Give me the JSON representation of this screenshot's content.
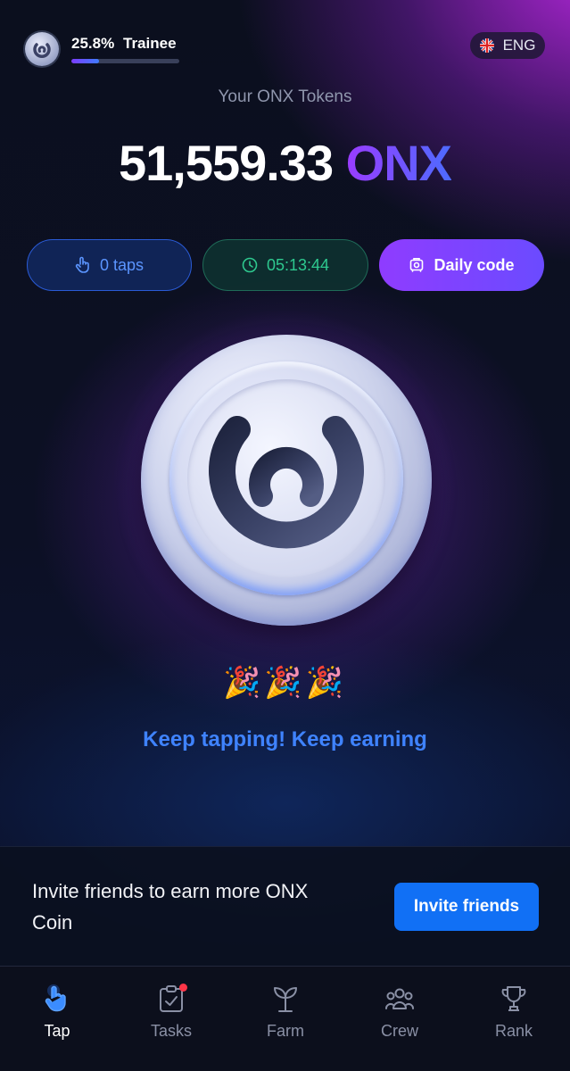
{
  "header": {
    "level_percent": "25.8%",
    "level_progress": 0.258,
    "level_name": "Trainee",
    "language": "ENG",
    "flag_icon": "uk-flag-icon"
  },
  "balance": {
    "label": "Your ONX Tokens",
    "amount": "51,559.33",
    "currency": "ONX"
  },
  "pills": {
    "taps": "0 taps",
    "timer": "05:13:44",
    "daily_code": "Daily code"
  },
  "coin": {
    "icon": "onx-coin-icon"
  },
  "celebration": {
    "emoji": "🎉🎉🎉",
    "message": "Keep tapping! Keep earning"
  },
  "invite": {
    "text": "Invite friends to earn more ONX Coin",
    "button": "Invite friends"
  },
  "nav": {
    "items": [
      {
        "label": "Tap",
        "icon": "tap-hand-icon",
        "active": true
      },
      {
        "label": "Tasks",
        "icon": "tasks-icon",
        "badge": true
      },
      {
        "label": "Farm",
        "icon": "sprout-icon"
      },
      {
        "label": "Crew",
        "icon": "crew-icon"
      },
      {
        "label": "Rank",
        "icon": "trophy-icon"
      }
    ]
  },
  "colors": {
    "accent_purple": "#8f3cff",
    "accent_blue": "#3f83ff",
    "timer_green": "#2ec98f",
    "invite_button": "#1170f5"
  }
}
